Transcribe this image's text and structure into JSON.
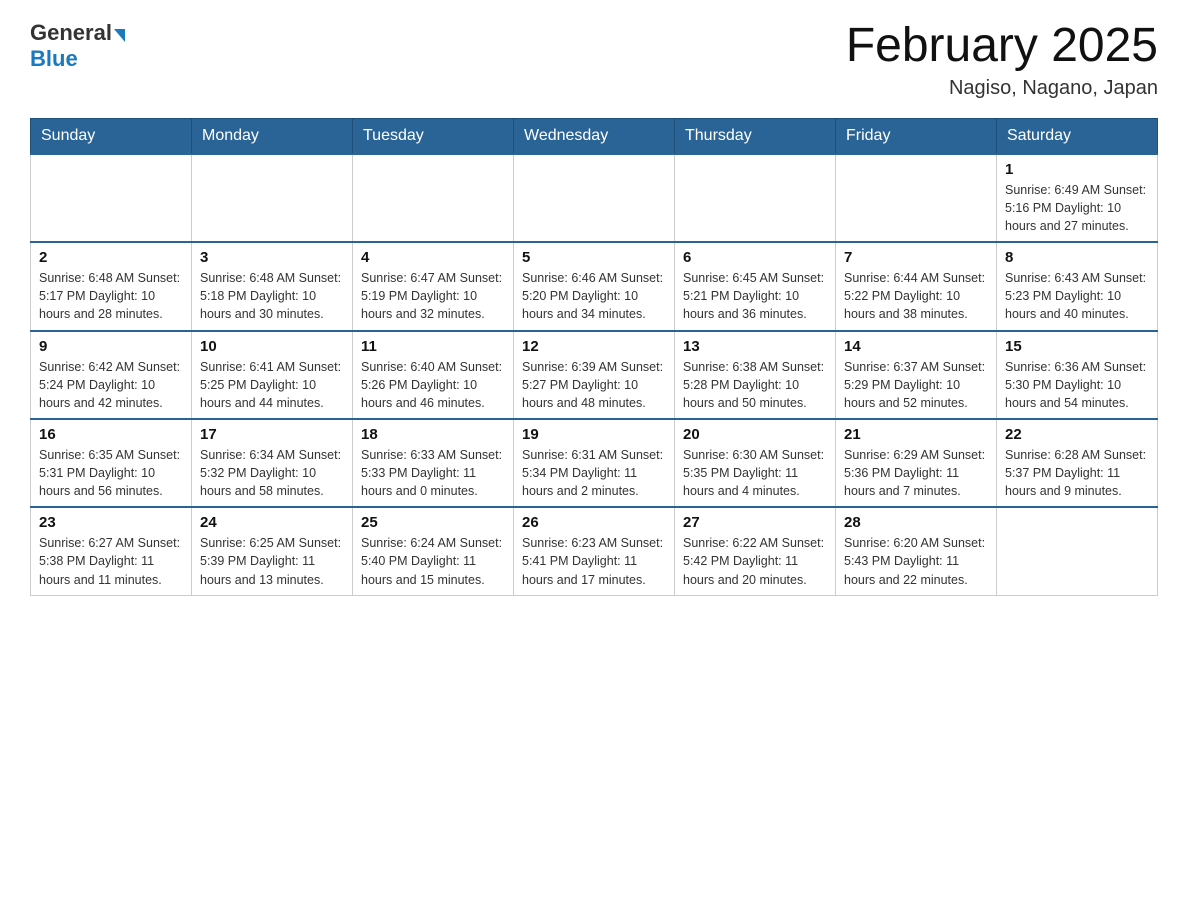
{
  "header": {
    "logo_general": "General",
    "logo_blue": "Blue",
    "month_title": "February 2025",
    "location": "Nagiso, Nagano, Japan"
  },
  "weekdays": [
    "Sunday",
    "Monday",
    "Tuesday",
    "Wednesday",
    "Thursday",
    "Friday",
    "Saturday"
  ],
  "weeks": [
    [
      {
        "day": "",
        "info": ""
      },
      {
        "day": "",
        "info": ""
      },
      {
        "day": "",
        "info": ""
      },
      {
        "day": "",
        "info": ""
      },
      {
        "day": "",
        "info": ""
      },
      {
        "day": "",
        "info": ""
      },
      {
        "day": "1",
        "info": "Sunrise: 6:49 AM\nSunset: 5:16 PM\nDaylight: 10 hours and 27 minutes."
      }
    ],
    [
      {
        "day": "2",
        "info": "Sunrise: 6:48 AM\nSunset: 5:17 PM\nDaylight: 10 hours and 28 minutes."
      },
      {
        "day": "3",
        "info": "Sunrise: 6:48 AM\nSunset: 5:18 PM\nDaylight: 10 hours and 30 minutes."
      },
      {
        "day": "4",
        "info": "Sunrise: 6:47 AM\nSunset: 5:19 PM\nDaylight: 10 hours and 32 minutes."
      },
      {
        "day": "5",
        "info": "Sunrise: 6:46 AM\nSunset: 5:20 PM\nDaylight: 10 hours and 34 minutes."
      },
      {
        "day": "6",
        "info": "Sunrise: 6:45 AM\nSunset: 5:21 PM\nDaylight: 10 hours and 36 minutes."
      },
      {
        "day": "7",
        "info": "Sunrise: 6:44 AM\nSunset: 5:22 PM\nDaylight: 10 hours and 38 minutes."
      },
      {
        "day": "8",
        "info": "Sunrise: 6:43 AM\nSunset: 5:23 PM\nDaylight: 10 hours and 40 minutes."
      }
    ],
    [
      {
        "day": "9",
        "info": "Sunrise: 6:42 AM\nSunset: 5:24 PM\nDaylight: 10 hours and 42 minutes."
      },
      {
        "day": "10",
        "info": "Sunrise: 6:41 AM\nSunset: 5:25 PM\nDaylight: 10 hours and 44 minutes."
      },
      {
        "day": "11",
        "info": "Sunrise: 6:40 AM\nSunset: 5:26 PM\nDaylight: 10 hours and 46 minutes."
      },
      {
        "day": "12",
        "info": "Sunrise: 6:39 AM\nSunset: 5:27 PM\nDaylight: 10 hours and 48 minutes."
      },
      {
        "day": "13",
        "info": "Sunrise: 6:38 AM\nSunset: 5:28 PM\nDaylight: 10 hours and 50 minutes."
      },
      {
        "day": "14",
        "info": "Sunrise: 6:37 AM\nSunset: 5:29 PM\nDaylight: 10 hours and 52 minutes."
      },
      {
        "day": "15",
        "info": "Sunrise: 6:36 AM\nSunset: 5:30 PM\nDaylight: 10 hours and 54 minutes."
      }
    ],
    [
      {
        "day": "16",
        "info": "Sunrise: 6:35 AM\nSunset: 5:31 PM\nDaylight: 10 hours and 56 minutes."
      },
      {
        "day": "17",
        "info": "Sunrise: 6:34 AM\nSunset: 5:32 PM\nDaylight: 10 hours and 58 minutes."
      },
      {
        "day": "18",
        "info": "Sunrise: 6:33 AM\nSunset: 5:33 PM\nDaylight: 11 hours and 0 minutes."
      },
      {
        "day": "19",
        "info": "Sunrise: 6:31 AM\nSunset: 5:34 PM\nDaylight: 11 hours and 2 minutes."
      },
      {
        "day": "20",
        "info": "Sunrise: 6:30 AM\nSunset: 5:35 PM\nDaylight: 11 hours and 4 minutes."
      },
      {
        "day": "21",
        "info": "Sunrise: 6:29 AM\nSunset: 5:36 PM\nDaylight: 11 hours and 7 minutes."
      },
      {
        "day": "22",
        "info": "Sunrise: 6:28 AM\nSunset: 5:37 PM\nDaylight: 11 hours and 9 minutes."
      }
    ],
    [
      {
        "day": "23",
        "info": "Sunrise: 6:27 AM\nSunset: 5:38 PM\nDaylight: 11 hours and 11 minutes."
      },
      {
        "day": "24",
        "info": "Sunrise: 6:25 AM\nSunset: 5:39 PM\nDaylight: 11 hours and 13 minutes."
      },
      {
        "day": "25",
        "info": "Sunrise: 6:24 AM\nSunset: 5:40 PM\nDaylight: 11 hours and 15 minutes."
      },
      {
        "day": "26",
        "info": "Sunrise: 6:23 AM\nSunset: 5:41 PM\nDaylight: 11 hours and 17 minutes."
      },
      {
        "day": "27",
        "info": "Sunrise: 6:22 AM\nSunset: 5:42 PM\nDaylight: 11 hours and 20 minutes."
      },
      {
        "day": "28",
        "info": "Sunrise: 6:20 AM\nSunset: 5:43 PM\nDaylight: 11 hours and 22 minutes."
      },
      {
        "day": "",
        "info": ""
      }
    ]
  ]
}
